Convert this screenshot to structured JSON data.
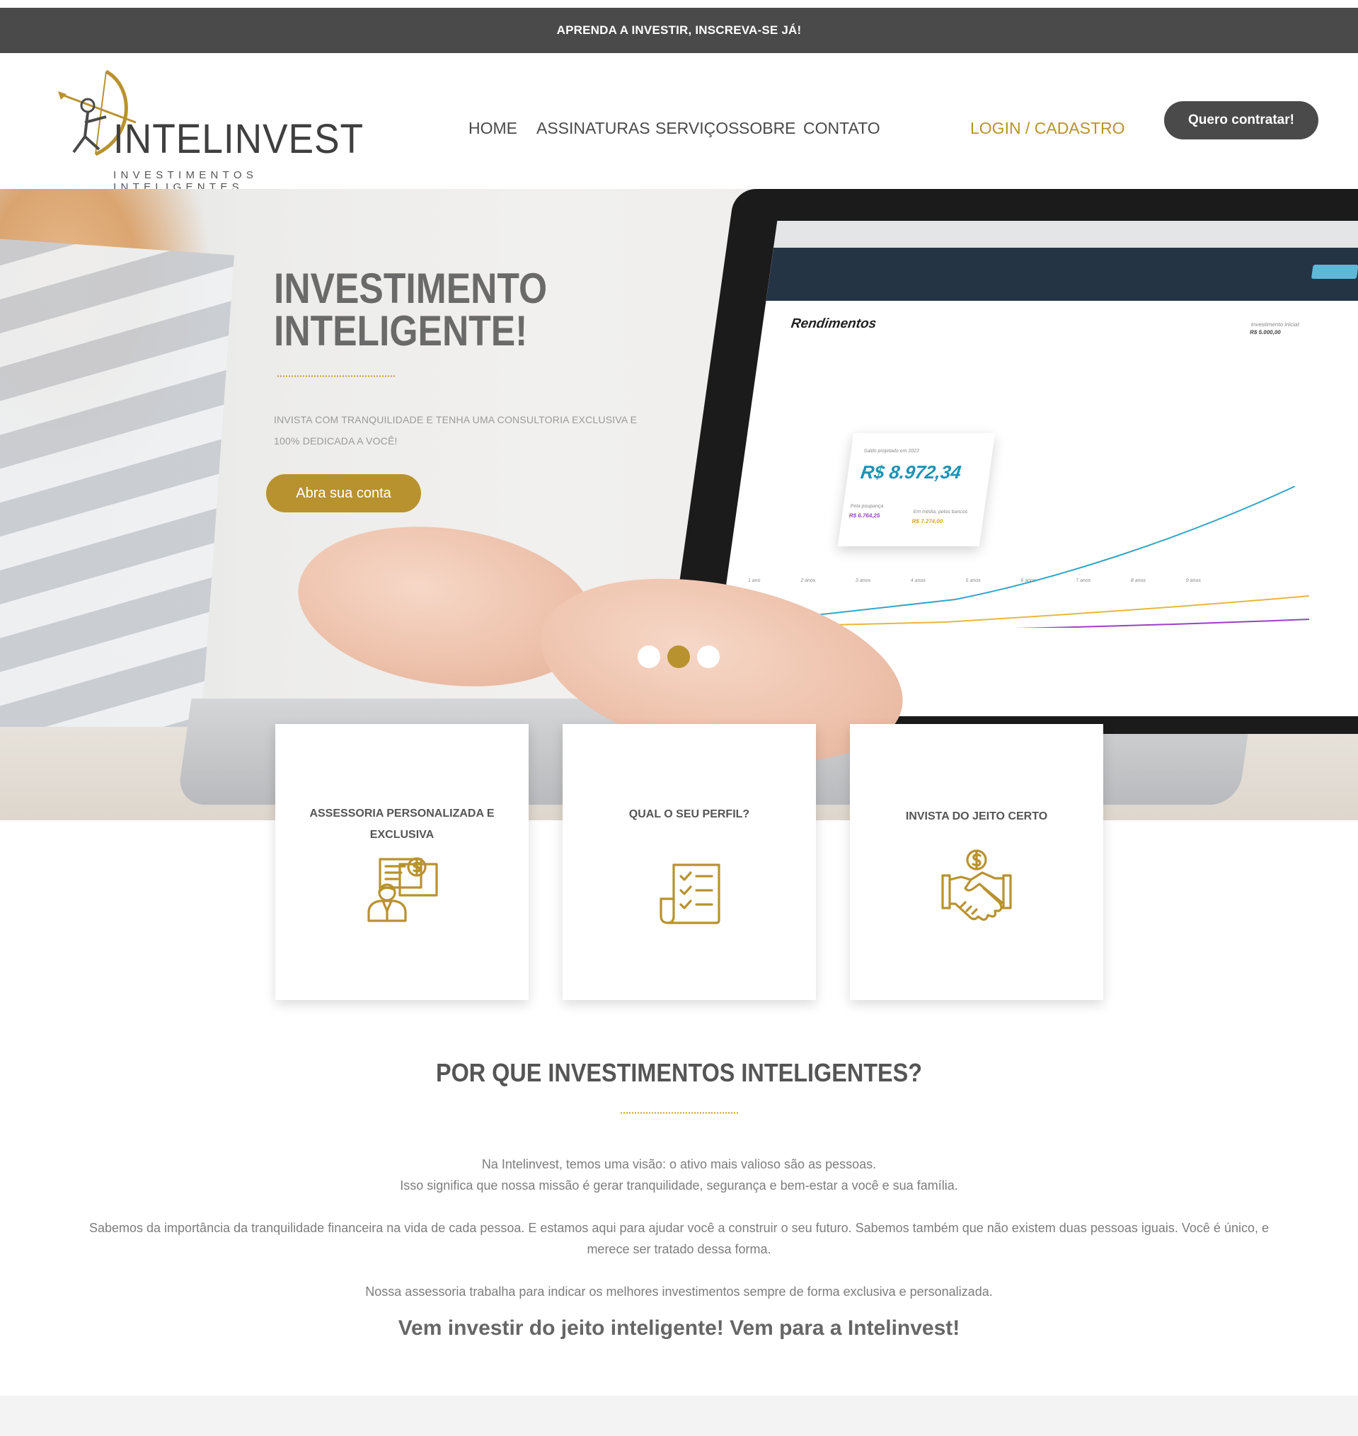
{
  "announcement": "APRENDA A INVESTIR, INSCREVA-SE JÁ!",
  "logo": {
    "brand": "INTELINVEST",
    "tagline": "INVESTIMENTOS INTELIGENTES",
    "icon": "archer-bow-icon"
  },
  "nav": [
    "HOME",
    "ASSINATURAS",
    "SERVIÇOS",
    "SOBRE",
    "CONTATO"
  ],
  "login": "LOGIN / CADASTRO",
  "cta": "Quero contratar!",
  "hero": {
    "title_line1": "INVESTIMENTO",
    "title_line2": "INTELIGENTE!",
    "subtitle_line1": "INVISTA COM TRANQUILIDADE E TENHA UMA CONSULTORIA EXCLUSIVA E",
    "subtitle_line2": "100% DEDICADA A VOCÊ!",
    "button": "Abra sua conta",
    "active_slide": 2,
    "slide_count": 3,
    "screen": {
      "title": "Rendimentos",
      "info_label": "Investimento inicial:",
      "info_value": "R$ 5.000,00",
      "bubble_label": "Saldo projetado em 2022",
      "bubble_amount": "R$ 8.972,34",
      "bubble_left_label": "Pela poupança",
      "bubble_left_value": "R$ 6.764,25",
      "bubble_right_label": "Em média, pelos bancos",
      "bubble_right_value": "R$ 7.274,00",
      "x_labels": [
        "1 ano",
        "2 anos",
        "3 anos",
        "4 anos",
        "5 anos",
        "6 anos",
        "7 anos",
        "8 anos",
        "9 anos"
      ]
    }
  },
  "cards": [
    {
      "title": "ASSESSORIA PERSONALIZADA E EXCLUSIVA",
      "icon": "consultant-icon"
    },
    {
      "title": "QUAL O SEU PERFIL?",
      "icon": "checklist-icon"
    },
    {
      "title": "INVISTA DO JEITO CERTO",
      "icon": "handshake-dollar-icon"
    }
  ],
  "why": {
    "title": "POR QUE INVESTIMENTOS INTELIGENTES?",
    "p1_line1": "Na Intelinvest, temos uma visão: o ativo mais valioso são as pessoas.",
    "p1_line2": "Isso significa que nossa missão é gerar tranquilidade, segurança e bem-estar a você e sua família.",
    "p2_line1": "Sabemos da importância da tranquilidade financeira na vida de cada pessoa. E estamos aqui para ajudar você a construir o seu futuro. Sabemos também que não existem duas pessoas iguais. Você é único, e",
    "p2_line2": "merece ser tratado dessa forma.",
    "p3": "Nossa assessoria trabalha para indicar os melhores investimentos sempre de forma exclusiva e personalizada.",
    "closing": "Vem investir do jeito inteligente! Vem para a Intelinvest!"
  },
  "colors": {
    "gold": "#b8922e",
    "dark": "#4a4a4a",
    "text": "#7d7d7d"
  }
}
